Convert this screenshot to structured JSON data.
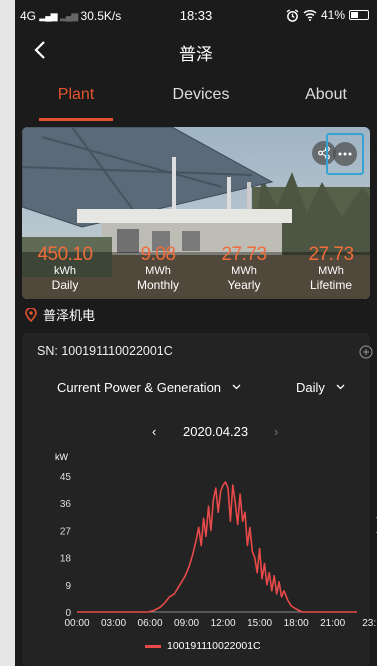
{
  "status_bar": {
    "network": "4G",
    "speed": "30.5K/s",
    "time": "18:33",
    "battery": "41%",
    "battery_level": 0.41
  },
  "nav": {
    "title": "普泽"
  },
  "tabs": [
    {
      "label": "Plant"
    },
    {
      "label": "Devices"
    },
    {
      "label": "About"
    }
  ],
  "stats": [
    {
      "value": "450.10",
      "unit": "kWh",
      "name": "Daily"
    },
    {
      "value": "9.08",
      "unit": "MWh",
      "name": "Monthly"
    },
    {
      "value": "27.73",
      "unit": "MWh",
      "name": "Yearly"
    },
    {
      "value": "27.73",
      "unit": "MWh",
      "name": "Lifetime"
    }
  ],
  "location": "普泽机电",
  "device": {
    "sn_label": "SN:",
    "sn": "100191110022001C"
  },
  "selectors": {
    "chart_type": "Current Power & Generation",
    "period": "Daily"
  },
  "date": "2020.04.23",
  "icons": {
    "share": "share-icon",
    "more": "more-icon",
    "back": "back-arrow-icon",
    "location": "location-pin-icon",
    "add": "add-circle-icon"
  },
  "colors": {
    "accent": "#e2542f",
    "line": "#e84a4a",
    "highlight": "#36a3d6"
  },
  "chart_data": {
    "type": "line",
    "ylabel": "kW",
    "ylim": [
      0,
      45
    ],
    "yticks": [
      0,
      9,
      18,
      27,
      36,
      45
    ],
    "xlim": [
      0,
      23
    ],
    "xticks": [
      "00:00",
      "03:00",
      "06:00",
      "09:00",
      "12:00",
      "15:00",
      "18:00",
      "21:00",
      "23:"
    ],
    "series": [
      {
        "name": "100191110022001C",
        "x": [
          0,
          5.8,
          6.3,
          6.8,
          7.2,
          7.6,
          8.0,
          8.3,
          8.6,
          8.9,
          9.2,
          9.5,
          9.8,
          10.0,
          10.2,
          10.4,
          10.6,
          10.8,
          11.0,
          11.2,
          11.4,
          11.6,
          11.8,
          12.0,
          12.2,
          12.4,
          12.6,
          12.8,
          13.0,
          13.2,
          13.4,
          13.6,
          13.8,
          14.0,
          14.2,
          14.4,
          14.6,
          14.8,
          15.0,
          15.2,
          15.4,
          15.6,
          15.8,
          16.0,
          16.2,
          16.4,
          16.6,
          16.8,
          17.0,
          17.3,
          17.6,
          18.0,
          18.5,
          23
        ],
        "y": [
          0,
          0,
          0.5,
          1.5,
          3,
          5,
          6,
          8,
          10,
          12,
          15,
          19,
          24,
          28,
          22,
          31,
          25,
          35,
          27,
          37,
          41,
          33,
          40,
          42,
          43,
          41,
          30,
          42,
          36,
          29,
          39,
          30,
          33,
          22,
          28,
          20,
          18,
          13,
          21,
          11,
          16,
          9,
          13,
          7,
          12,
          6,
          10,
          5,
          7,
          4,
          2,
          1,
          0,
          0
        ]
      }
    ]
  }
}
